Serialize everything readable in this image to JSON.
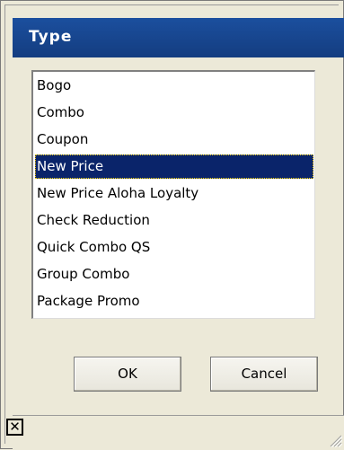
{
  "dialog": {
    "title": "Type"
  },
  "list": {
    "items": [
      "Bogo",
      "Combo",
      "Coupon",
      "New Price",
      "New Price Aloha Loyalty",
      "Check Reduction",
      "Quick Combo QS",
      "Group Combo",
      "Package Promo"
    ],
    "selected": "New Price"
  },
  "buttons": {
    "ok_label": "OK",
    "cancel_label": "Cancel"
  },
  "statusbar": {
    "close_glyph": "✕"
  },
  "colors": {
    "titlebar": "#1b4f9e",
    "selection": "#0a246a",
    "background": "#ece9d8"
  }
}
